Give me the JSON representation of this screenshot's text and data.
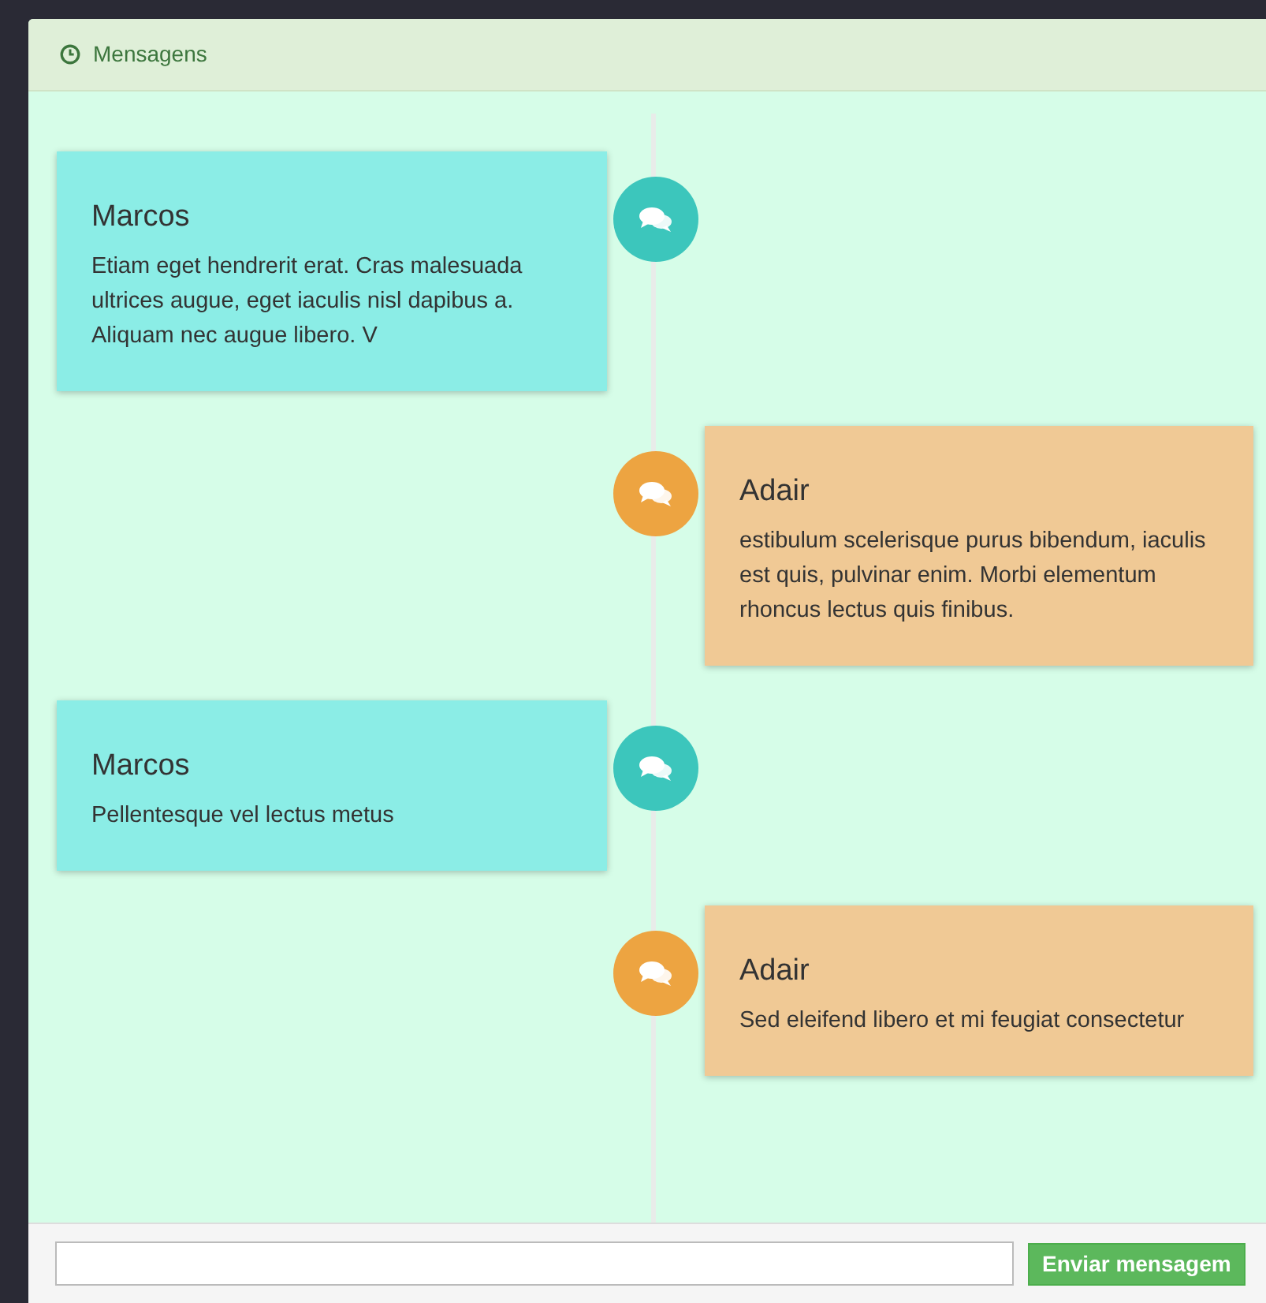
{
  "panel": {
    "title": "Mensagens"
  },
  "messages": [
    {
      "kind": "left",
      "author": "Marcos",
      "text": "Etiam eget hendrerit erat. Cras malesuada ultrices augue, eget iaculis nisl dapibus a. Aliquam nec augue libero. V"
    },
    {
      "kind": "right",
      "author": "Adair",
      "text": "estibulum scelerisque purus bibendum, iaculis est quis, pulvinar enim. Morbi elementum rhoncus lectus quis finibus."
    },
    {
      "kind": "left",
      "author": "Marcos",
      "text": "Pellentesque vel lectus metus"
    },
    {
      "kind": "right",
      "author": "Adair",
      "text": "Sed eleifend libero et mi feugiat consectetur"
    }
  ],
  "composer": {
    "button": "Enviar mensagem"
  }
}
